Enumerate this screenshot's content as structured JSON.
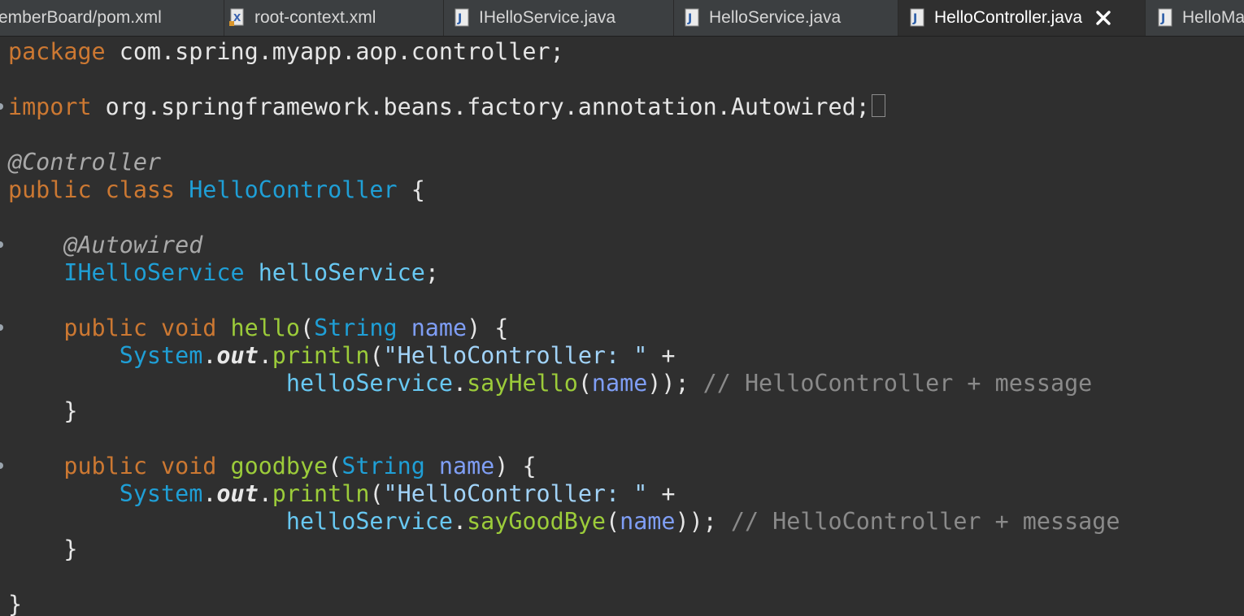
{
  "tabs": [
    {
      "label": "emberBoard/pom.xml",
      "icon": "none"
    },
    {
      "label": "root-context.xml",
      "icon": "xml-file-icon"
    },
    {
      "label": "IHelloService.java",
      "icon": "java-file-icon"
    },
    {
      "label": "HelloService.java",
      "icon": "java-file-icon"
    },
    {
      "label": "HelloController.java",
      "icon": "java-file-icon",
      "active": true
    },
    {
      "label": "HelloMa",
      "icon": "java-file-icon"
    }
  ],
  "code": {
    "l1": {
      "kw": "package",
      "rest": " com.spring.myapp.aop.controller;"
    },
    "l2": {
      "kw": "import",
      "rest": " org.springframework.beans.factory.annotation.Autowired;"
    },
    "l3": {
      "ann": "@Controller"
    },
    "l4": {
      "kw": "public class",
      "cls": "HelloController",
      "rest": " {"
    },
    "l5": {
      "ann": "@Autowired"
    },
    "l6": {
      "type": "IHelloService",
      "field": "helloService",
      "rest": ";"
    },
    "l7": {
      "kw": "public void",
      "method": "hello",
      "open": "(",
      "type": "String",
      "param": "name",
      "close": ") {"
    },
    "l8": {
      "cls": "System",
      "dot": ".",
      "stat": "out",
      "dot2": ".",
      "method": "println",
      "open": "(",
      "str": "\"HelloController: \"",
      "plus": " +"
    },
    "l9": {
      "field": "helloService",
      "dot": ".",
      "method": "sayHello",
      "open": "(",
      "param": "name",
      "close": "));",
      "comment": "// HelloController + message"
    },
    "l10": {
      "brace": "}"
    },
    "l11": {
      "kw": "public void",
      "method": "goodbye",
      "open": "(",
      "type": "String",
      "param": "name",
      "close": ") {"
    },
    "l12": {
      "cls": "System",
      "dot": ".",
      "stat": "out",
      "dot2": ".",
      "method": "println",
      "open": "(",
      "str": "\"HelloController: \"",
      "plus": " +"
    },
    "l13": {
      "field": "helloService",
      "dot": ".",
      "method": "sayGoodBye",
      "open": "(",
      "param": "name",
      "close": "));",
      "comment": "// HelloController + message"
    },
    "l14": {
      "brace": "}"
    },
    "l15": {
      "brace": "}"
    }
  },
  "colors": {
    "keyword": "#cc7832",
    "annotation": "#a9a9a9",
    "class": "#1f9fd6",
    "field": "#68c8f2",
    "method": "#9ccc3a",
    "param": "#7f9ef5",
    "comment": "#8a8a8a",
    "background": "#2f2f2f"
  }
}
